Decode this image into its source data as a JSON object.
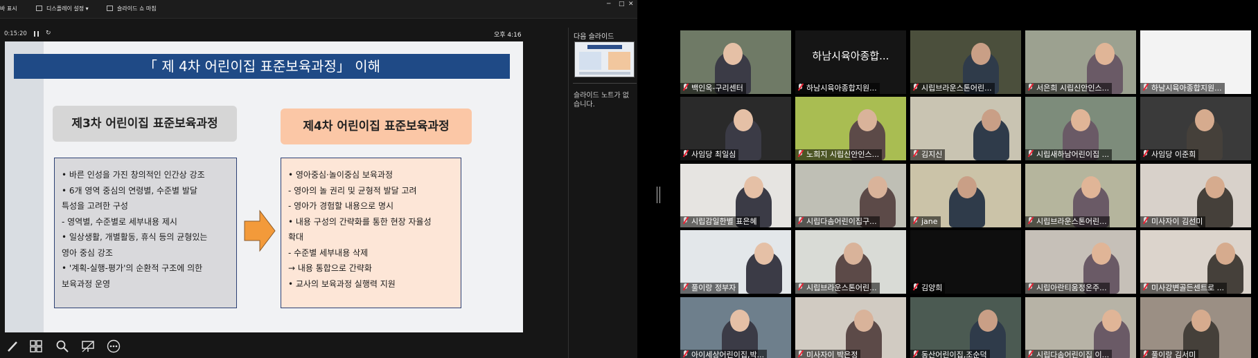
{
  "toolbar": {
    "item1": "바 표시",
    "item2": "디스플레이 설정 ▾",
    "item3": "슬라이드 쇼 마침",
    "win_min": "─",
    "win_max": "□",
    "win_close": "✕"
  },
  "presenter": {
    "timer": "0:15:20",
    "restart_glyph": "↻",
    "clock": "오후 4:16",
    "next_slide_label": "다음 슬라이드",
    "notes_text": "슬라이드 노트가 없습니다."
  },
  "slide": {
    "title": "「 제 4차 어린이집 표준보육과정」 이해",
    "left_header": "제3차 어린이집 표준보육과정",
    "right_header": "제4차 어린이집 표준보육과정",
    "left_lines": [
      "• 바른 인성을 가진 창의적인 인간상 강조",
      "• 6개 영역 중심의 연령별, 수준별 발달",
      "  특성을 고려한 구성",
      " - 영역별, 수준별로 세부내용 제시",
      "• 일상생활, 개별활동, 휴식 등의 균형있는",
      "  영아 중심 강조",
      "• '계획-실행-평가'의 순환적 구조에 의한",
      "  보육과정 운영"
    ],
    "right_lines": [
      "• 영아중심·놀이중심 보육과정",
      " - 영아의 놀 권리 및 균형적 발달 고려",
      " - 영아가 경험할 내용으로 명시",
      "• 내용 구성의 간략화를 통한 현장 자율성",
      "  확대",
      " - 수준별 세부내용 삭제",
      "   → 내용 통합으로 간략화",
      "• 교사의 보육과정 실행력 지원"
    ],
    "colors": {
      "title_bar": "#1f4a86",
      "left_header": "#d6d6d6",
      "right_header": "#fbc7a6",
      "arrow": "#f39a3a"
    }
  },
  "gallery": {
    "participants": [
      {
        "name": "백인옥-구리센터",
        "active": true
      },
      {
        "name": "하남시육아종합지원...",
        "display_name": "하남시육아종합..."
      },
      {
        "name": "시립브라운스톤어린..."
      },
      {
        "name": "서은희 시립신안인스..."
      },
      {
        "name": "하남시육아종합지원..."
      },
      {
        "name": "사임당 최일심"
      },
      {
        "name": "노희지 시립신안인스..."
      },
      {
        "name": "김지신"
      },
      {
        "name": "시립새하남어린이집 ..."
      },
      {
        "name": "사임당 이준희"
      },
      {
        "name": "시립감일한별 표은혜"
      },
      {
        "name": "시립다솜어린이집구..."
      },
      {
        "name": "jane"
      },
      {
        "name": "시립브라운스톤어린..."
      },
      {
        "name": "미사자이 김선미"
      },
      {
        "name": "풀이랑 정부자"
      },
      {
        "name": "시립브라운스톤어린..."
      },
      {
        "name": "김양희"
      },
      {
        "name": "시립아란티움정온주..."
      },
      {
        "name": "미사강변골든센트로 ..."
      },
      {
        "name": "아이세상어린이집,박..."
      },
      {
        "name": "미사자이 박은정"
      },
      {
        "name": "동산어린이집,조순덕"
      },
      {
        "name": "시립다솜어린이집 이..."
      },
      {
        "name": "풀이랑 김서미"
      }
    ]
  }
}
